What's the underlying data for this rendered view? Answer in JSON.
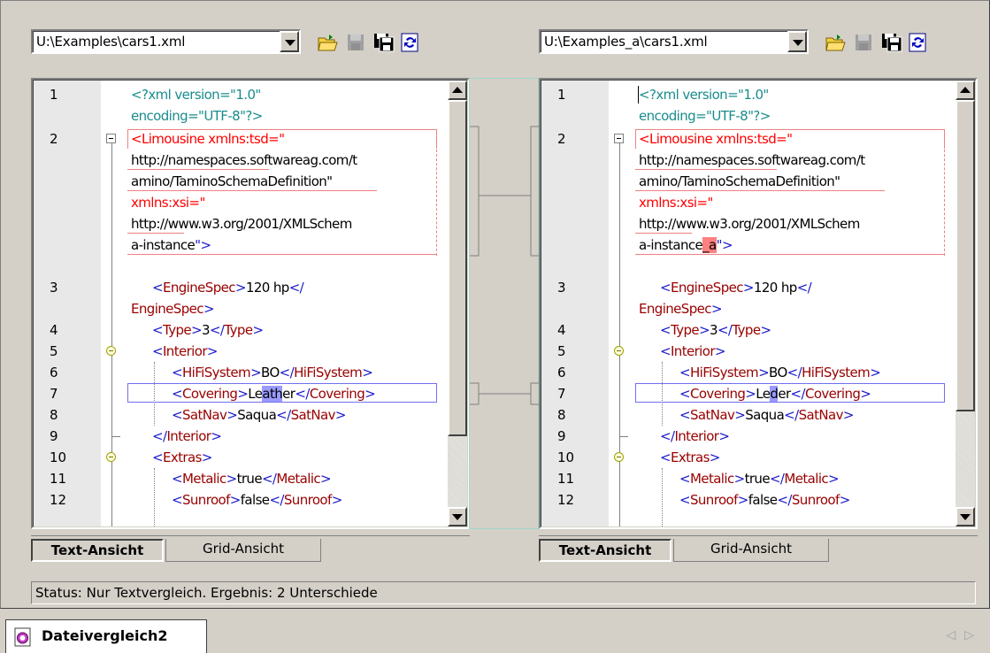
{
  "left": {
    "path": "U:\\Examples\\cars1.xml",
    "tabs": {
      "text": "Text-Ansicht",
      "grid": "Grid-Ansicht"
    }
  },
  "right": {
    "path": "U:\\Examples_a\\cars1.xml",
    "tabs": {
      "text": "Text-Ansicht",
      "grid": "Grid-Ansicht"
    }
  },
  "lines": {
    "n1": "1",
    "n2": "2",
    "n3": "3",
    "n4": "4",
    "n5": "5",
    "n6": "6",
    "n7": "7",
    "n8": "8",
    "n9": "9",
    "n10": "10",
    "n11": "11",
    "n12": "12"
  },
  "code": {
    "pi1": "<?xml version=\"1.0\"",
    "pi2": "encoding=\"UTF-8\"?>",
    "limo_open": "<",
    "limo_name": "Limousine",
    "limo_attr1": " xmlns:tsd=\"",
    "ns1a": "http://namespaces.softwareag.com/t",
    "ns1b": "amino/TaminoSchemaDefinition\"",
    "attr2": "xmlns:xsi=\"",
    "ns2": "http://www.w3.org/2001/XMLSchem",
    "ns3_left": "a-instance",
    "ns3_right_a": "a-instance",
    "ns3_right_diff": "_a",
    "ns3_end": "\">",
    "engine_open": "EngineSpec",
    "engine_val": "120 hp",
    "engine_close": "EngineSpec",
    "type_name": "Type",
    "type_val": "3",
    "interior": "Interior",
    "hifi": "HiFiSystem",
    "hifi_val": "BO",
    "covering": "Covering",
    "cov_left_a": "Le",
    "cov_left_diff": "ath",
    "cov_left_b": "er",
    "cov_right_a": "Le",
    "cov_right_diff": "d",
    "cov_right_b": "er",
    "satnav": "SatNav",
    "satnav_val": "Saqua",
    "extras": "Extras",
    "metalic": "Metalic",
    "metalic_val": "true",
    "sunroof": "Sunroof",
    "sunroof_val": "false"
  },
  "status": "Status: Nur Textvergleich. Ergebnis: 2 Unterschiede",
  "doc_tab": "Dateivergleich2",
  "colors": {
    "diff_red": "#f08080",
    "diff_blue": "#7070f0",
    "tag_blue": "#1a1acc",
    "tag_name": "#990000",
    "pi": "#1a8c8c"
  }
}
